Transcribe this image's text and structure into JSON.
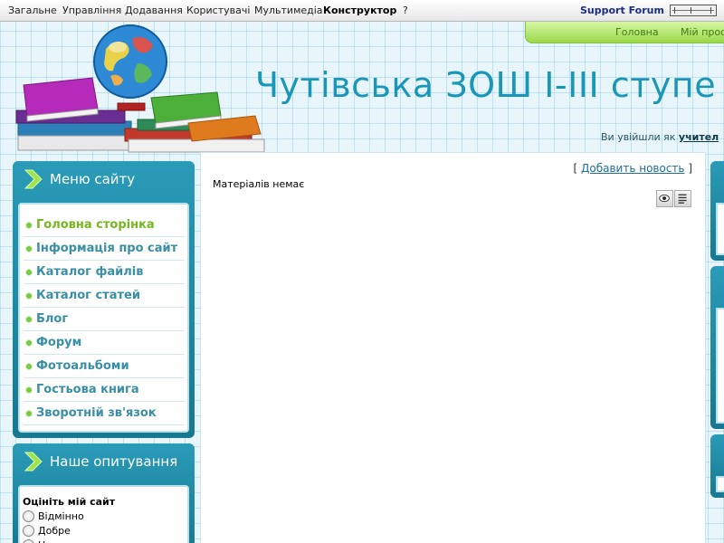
{
  "admin_bar": {
    "menu": [
      "Загальне",
      "Управління",
      "Додавання",
      "Користувачі",
      "Мультимедіа",
      "Конструктор",
      "?"
    ],
    "support": "Support Forum"
  },
  "header": {
    "title": "Чутівська ЗОШ I-III ступе",
    "nav": [
      "Головна",
      "Мій проф"
    ],
    "logged_prefix": "Ви увійшли як",
    "logged_user": "учител"
  },
  "menu_block": {
    "title": "Меню сайту",
    "items": [
      {
        "label": "Головна сторінка"
      },
      {
        "label": "Інформація про сайт"
      },
      {
        "label": "Каталог файлів"
      },
      {
        "label": "Каталог статей"
      },
      {
        "label": "Блог"
      },
      {
        "label": "Форум"
      },
      {
        "label": "Фотоальбоми"
      },
      {
        "label": "Гостьова книга"
      },
      {
        "label": "Зворотній зв'язок"
      }
    ]
  },
  "poll_block": {
    "title": "Наше опитування",
    "question": "Оцініть мій сайт",
    "options": [
      "Відмінно",
      "Добре",
      "Н"
    ]
  },
  "main": {
    "add_news_open": "[",
    "add_news_label": "Добавить новость",
    "add_news_close": "]",
    "no_materials": "Матеріалів немає"
  },
  "colors": {
    "title": "#1a96b8",
    "sidebar": "#2a9bb8",
    "menu_link": "#3a8fa6",
    "menu_active": "#74b81e",
    "green_bar": "#9ad84a"
  },
  "icons": {
    "block_header": "chevron-right-icon",
    "view_mode": "eye-icon",
    "list_mode": "list-icon"
  }
}
